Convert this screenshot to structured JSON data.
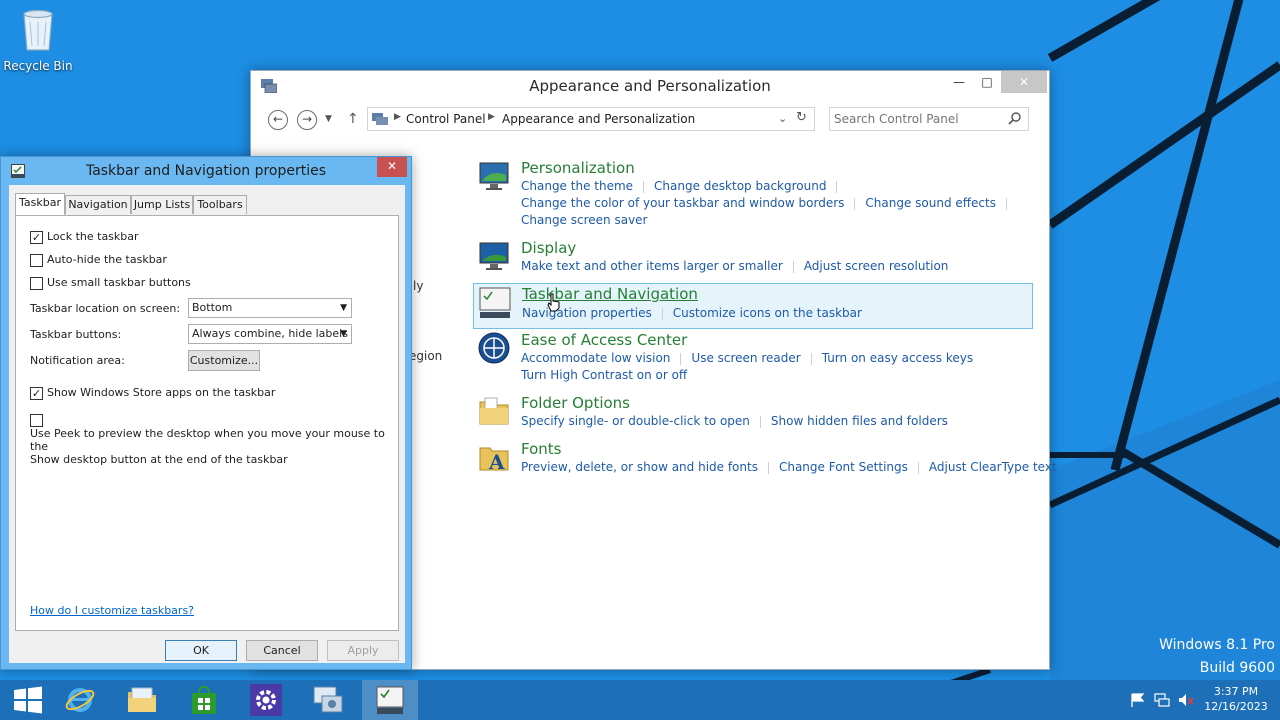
{
  "desktop": {
    "recycle_bin_label": "Recycle Bin",
    "watermark_line1": "Windows 8.1 Pro",
    "watermark_line2": "Build 9600"
  },
  "control_panel": {
    "title": "Appearance and Personalization",
    "address": {
      "crumb1": "Control Panel",
      "crumb2": "Appearance and Personalization"
    },
    "search_placeholder": "Search Control Panel",
    "left_fragments": [
      "ly",
      "egion"
    ],
    "categories": [
      {
        "title": "Personalization",
        "icon": "personalization-icon",
        "lines": [
          [
            "Change the theme",
            "Change desktop background"
          ],
          [
            "Change the color of your taskbar and window borders",
            "Change sound effects"
          ],
          [
            "Change screen saver"
          ]
        ]
      },
      {
        "title": "Display",
        "icon": "display-icon",
        "lines": [
          [
            "Make text and other items larger or smaller",
            "Adjust screen resolution"
          ]
        ]
      },
      {
        "title": "Taskbar and Navigation",
        "icon": "taskbar-navigation-icon",
        "lines": [
          [
            "Navigation properties",
            "Customize icons on the taskbar"
          ]
        ]
      },
      {
        "title": "Ease of Access Center",
        "icon": "ease-of-access-icon",
        "lines": [
          [
            "Accommodate low vision",
            "Use screen reader",
            "Turn on easy access keys"
          ],
          [
            "Turn High Contrast on or off"
          ]
        ]
      },
      {
        "title": "Folder Options",
        "icon": "folder-options-icon",
        "lines": [
          [
            "Specify single- or double-click to open",
            "Show hidden files and folders"
          ]
        ]
      },
      {
        "title": "Fonts",
        "icon": "fonts-icon",
        "lines": [
          [
            "Preview, delete, or show and hide fonts",
            "Change Font Settings",
            "Adjust ClearType text"
          ]
        ]
      }
    ]
  },
  "dialog": {
    "title": "Taskbar and Navigation properties",
    "tabs": [
      "Taskbar",
      "Navigation",
      "Jump Lists",
      "Toolbars"
    ],
    "active_tab": "Taskbar",
    "checkboxes": {
      "lock_taskbar": {
        "label": "Lock the taskbar",
        "checked": true
      },
      "auto_hide": {
        "label": "Auto-hide the taskbar",
        "checked": false
      },
      "small_buttons": {
        "label": "Use small taskbar buttons",
        "checked": false
      },
      "store_apps": {
        "label": "Show Windows Store apps on the taskbar",
        "checked": true
      },
      "peek_line1": "Use Peek to preview the desktop when you move your mouse to the",
      "peek_line2": "Show desktop button at the end of the taskbar",
      "peek_checked": false
    },
    "location_label": "Taskbar location on screen:",
    "location_value": "Bottom",
    "buttons_label": "Taskbar buttons:",
    "buttons_value": "Always combine, hide labels",
    "notification_label": "Notification area:",
    "customize_label": "Customize...",
    "help_link": "How do I customize taskbars?",
    "ok_label": "OK",
    "cancel_label": "Cancel",
    "apply_label": "Apply"
  },
  "taskbar": {
    "pinned": [
      "start-button",
      "internet-explorer",
      "file-explorer",
      "windows-store",
      "settings",
      "control-panel",
      "taskbar-properties"
    ],
    "active_index": 6,
    "clock_time": "3:37 PM",
    "clock_date": "12/16/2023"
  },
  "colors": {
    "desktop_blue": "#1d8ee4",
    "taskbar_blue": "#1d6fb8",
    "dialog_frame": "#6ab8f2",
    "category_title_green": "#267f35",
    "link_blue": "#1e5aa8",
    "highlight_bg": "#e5f3fb",
    "highlight_border": "#70c0e7"
  }
}
